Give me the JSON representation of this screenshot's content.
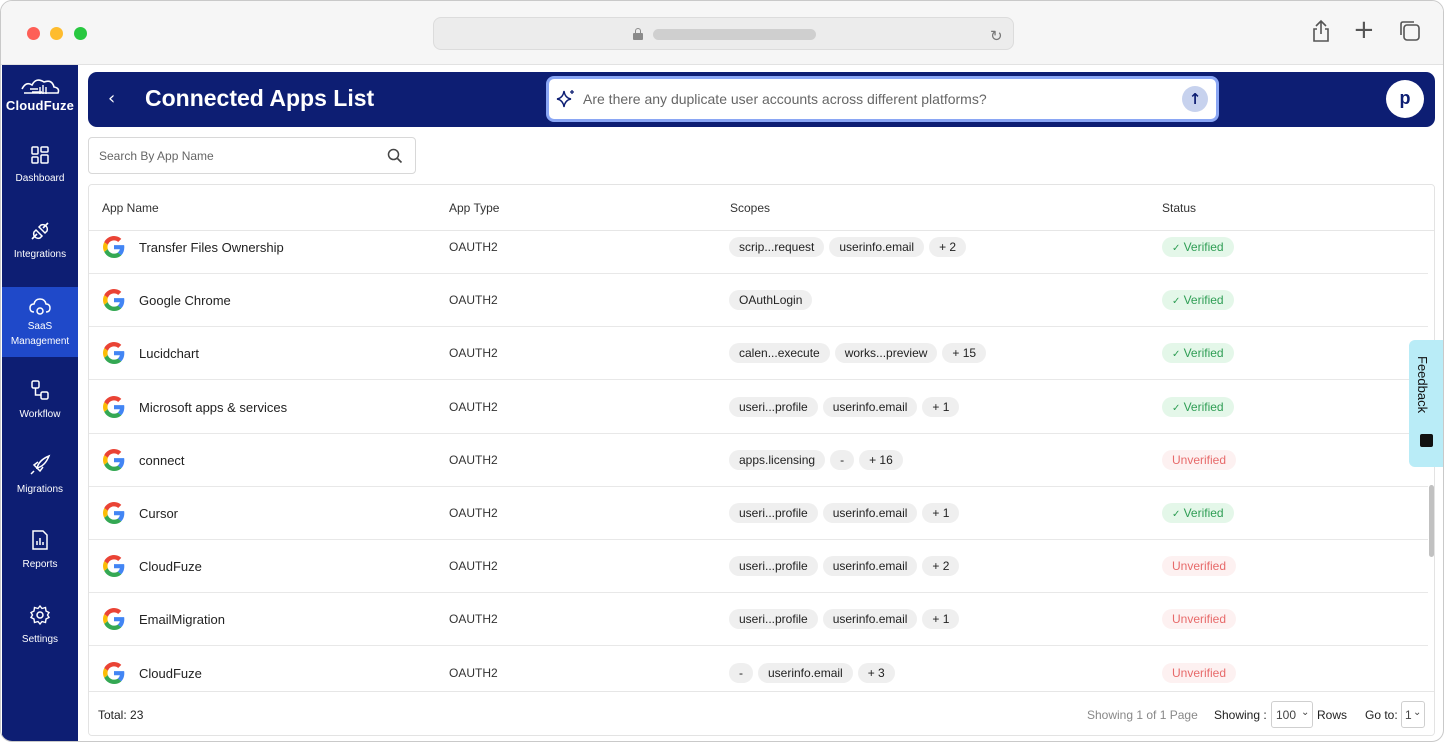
{
  "sidebar": {
    "logo_text": "CloudFuze",
    "items": [
      {
        "label": "Dashboard",
        "icon": "dashboard-icon"
      },
      {
        "label": "Integrations",
        "icon": "plug-icon"
      },
      {
        "label": "SaaS Management",
        "icon": "cloud-gear-icon",
        "active": true
      },
      {
        "label": "Workflow",
        "icon": "workflow-icon"
      },
      {
        "label": "Migrations",
        "icon": "rocket-icon"
      },
      {
        "label": "Reports",
        "icon": "report-icon"
      },
      {
        "label": "Settings",
        "icon": "gear-icon"
      }
    ]
  },
  "header": {
    "title": "Connected Apps List",
    "ai_placeholder": "Are there any duplicate user accounts across different platforms?",
    "avatar_letter": "p"
  },
  "search": {
    "placeholder": "Search By App Name"
  },
  "table": {
    "columns": [
      "App Name",
      "App Type",
      "Scopes",
      "Status"
    ],
    "rows": [
      {
        "name": "Transfer Files Ownership",
        "type": "OAUTH2",
        "scopes": [
          "scrip...request",
          "userinfo.email",
          "+ 2"
        ],
        "status": "Verified"
      },
      {
        "name": "Google Chrome",
        "type": "OAUTH2",
        "scopes": [
          "OAuthLogin"
        ],
        "status": "Verified"
      },
      {
        "name": "Lucidchart",
        "type": "OAUTH2",
        "scopes": [
          "calen...execute",
          "works...preview",
          "+ 15"
        ],
        "status": "Verified"
      },
      {
        "name": "Microsoft apps & services",
        "type": "OAUTH2",
        "scopes": [
          "useri...profile",
          "userinfo.email",
          "+ 1"
        ],
        "status": "Verified"
      },
      {
        "name": "connect",
        "type": "OAUTH2",
        "scopes": [
          "apps.licensing",
          "-",
          "+ 16"
        ],
        "status": "Unverified"
      },
      {
        "name": "Cursor",
        "type": "OAUTH2",
        "scopes": [
          "useri...profile",
          "userinfo.email",
          "+ 1"
        ],
        "status": "Verified"
      },
      {
        "name": "CloudFuze",
        "type": "OAUTH2",
        "scopes": [
          "useri...profile",
          "userinfo.email",
          "+ 2"
        ],
        "status": "Unverified"
      },
      {
        "name": "EmailMigration",
        "type": "OAUTH2",
        "scopes": [
          "useri...profile",
          "userinfo.email",
          "+ 1"
        ],
        "status": "Unverified"
      },
      {
        "name": "CloudFuze",
        "type": "OAUTH2",
        "scopes": [
          "-",
          "userinfo.email",
          "+ 3"
        ],
        "status": "Unverified"
      }
    ]
  },
  "footer": {
    "total": "Total: 23",
    "showing_page": "Showing 1 of 1 Page",
    "showing_label": "Showing :",
    "rows_per_page": "100",
    "rows_label": "Rows",
    "goto_label": "Go to:",
    "goto_value": "1"
  },
  "feedback": {
    "label": "Feedback"
  },
  "colors": {
    "navy": "#0d1e73",
    "active_nav": "#1f49c9",
    "verified": "#2f9e55",
    "unverified": "#e76a6a"
  }
}
